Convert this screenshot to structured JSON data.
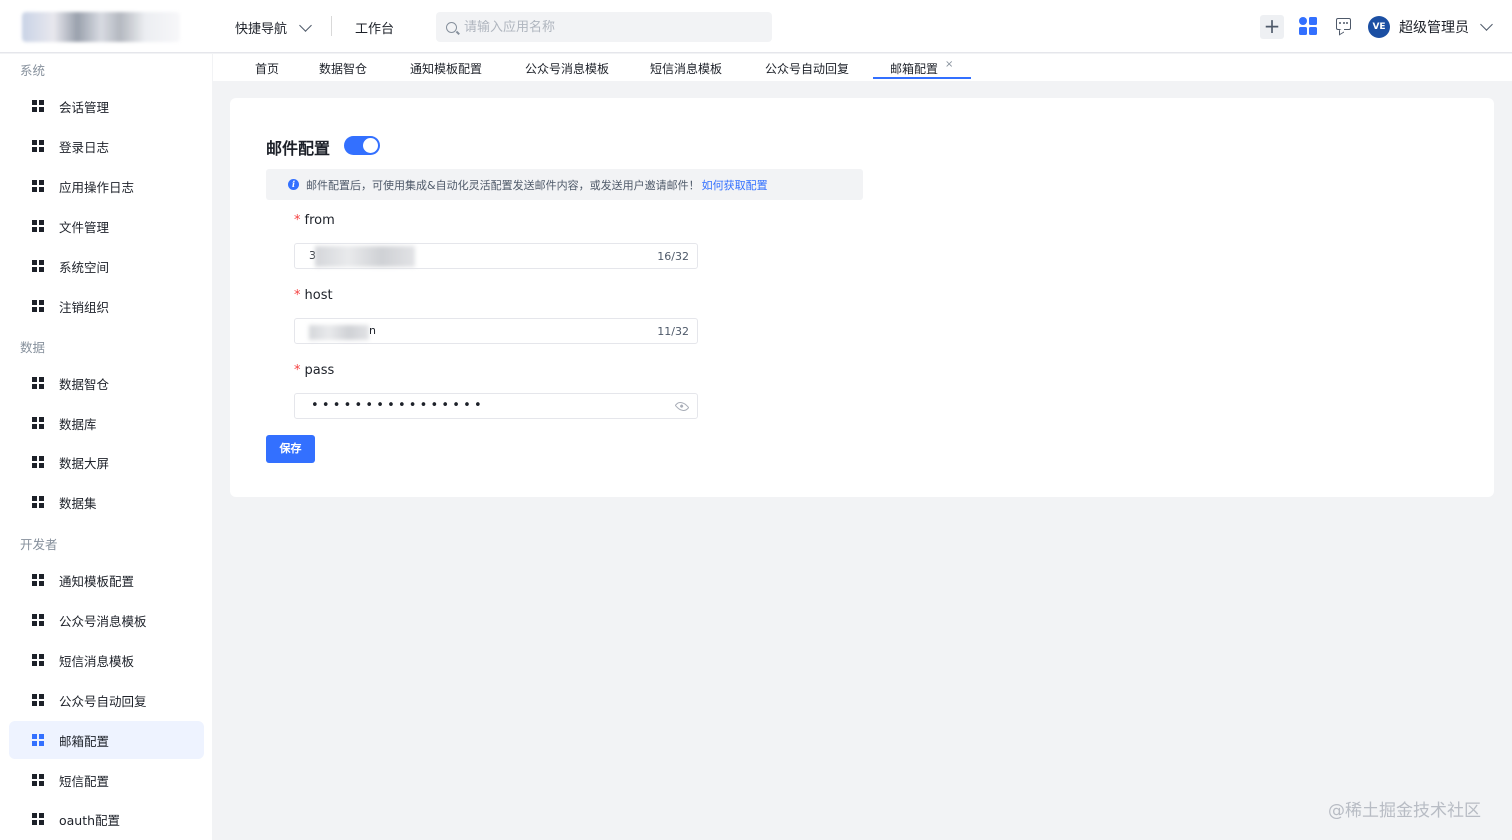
{
  "header": {
    "quick_nav": "快捷导航",
    "workbench": "工作台",
    "search_placeholder": "请输入应用名称",
    "avatar_text": "VE",
    "user_name": "超级管理员"
  },
  "sidebar": {
    "groups": [
      {
        "title": "系统",
        "items": [
          "会话管理",
          "登录日志",
          "应用操作日志",
          "文件管理",
          "系统空间",
          "注销组织"
        ]
      },
      {
        "title": "数据",
        "items": [
          "数据智仓",
          "数据库",
          "数据大屏",
          "数据集"
        ]
      },
      {
        "title": "开发者",
        "items": [
          "通知模板配置",
          "公众号消息模板",
          "短信消息模板",
          "公众号自动回复",
          "邮箱配置",
          "短信配置",
          "oauth配置"
        ]
      }
    ],
    "active_item": "邮箱配置"
  },
  "tabs": [
    "首页",
    "数据智仓",
    "通知模板配置",
    "公众号消息模板",
    "短信消息模板",
    "公众号自动回复",
    "邮箱配置"
  ],
  "active_tab": "邮箱配置",
  "tab_close": "×",
  "form": {
    "title": "邮件配置",
    "enabled": true,
    "alert_text": "邮件配置后，可使用集成&自动化灵活配置发送邮件内容，或发送用户邀请邮件！",
    "alert_link": "如何获取配置",
    "fields": [
      {
        "label": "from",
        "required_mark": "*",
        "visible_value": "3",
        "count": "16/32"
      },
      {
        "label": "host",
        "required_mark": "*",
        "visible_value": "n",
        "count": "11/32"
      },
      {
        "label": "pass",
        "required_mark": "*",
        "masked_value": "••••••••••••••••"
      }
    ],
    "save_label": "保存"
  },
  "watermark": "@稀土掘金技术社区",
  "colors": {
    "primary": "#3370ff",
    "required": "#f53f3f",
    "background": "#f2f3f5"
  }
}
